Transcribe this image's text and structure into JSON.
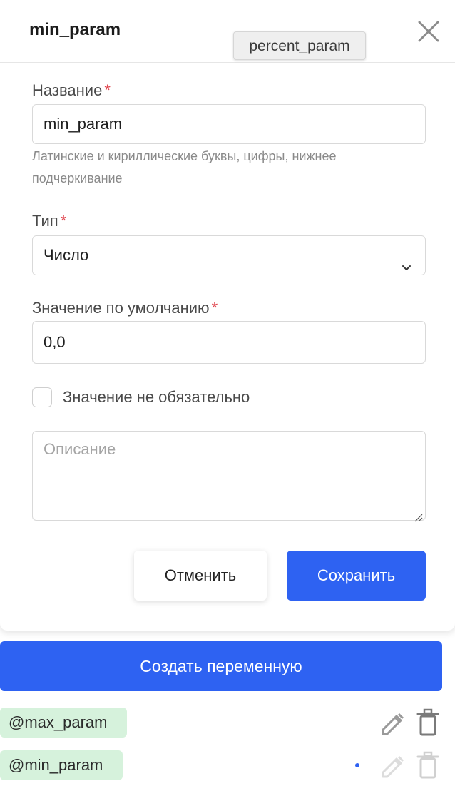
{
  "form": {
    "title": "min_param",
    "tooltip": "percent_param",
    "name": {
      "label": "Название",
      "required_mark": "*",
      "value": "min_param",
      "hint": "Латинские и кириллические буквы, цифры, нижнее подчеркивание"
    },
    "type": {
      "label": "Тип",
      "required_mark": "*",
      "value": "Число"
    },
    "default_value": {
      "label": "Значение по умолчанию",
      "required_mark": "*",
      "value": "0,0"
    },
    "optional": {
      "label": "Значение не обязательно",
      "checked": false
    },
    "description": {
      "placeholder": "Описание",
      "value": ""
    },
    "cancel_label": "Отменить",
    "save_label": "Сохранить"
  },
  "create_label": "Создать переменную",
  "variables": [
    {
      "name": "@max_param"
    },
    {
      "name": "@min_param"
    }
  ],
  "colors": {
    "accent": "#2e62f2",
    "required": "#e0464f",
    "tag_bg": "#d6f2dc"
  }
}
